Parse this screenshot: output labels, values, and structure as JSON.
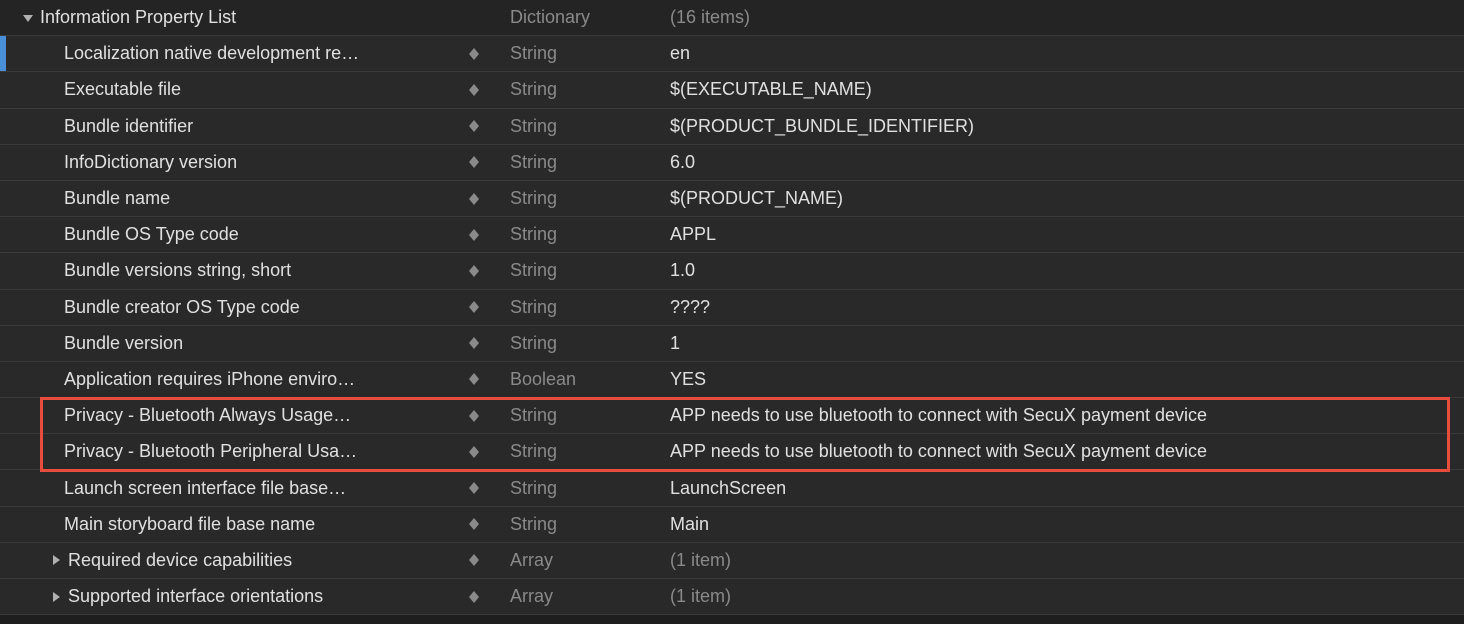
{
  "root": {
    "key": "Information Property List",
    "type": "Dictionary",
    "value": "(16 items)"
  },
  "rows": [
    {
      "key": "Localization native development re…",
      "type": "String",
      "value": "en",
      "stepper": true,
      "selected": true
    },
    {
      "key": "Executable file",
      "type": "String",
      "value": "$(EXECUTABLE_NAME)",
      "stepper": true
    },
    {
      "key": "Bundle identifier",
      "type": "String",
      "value": "$(PRODUCT_BUNDLE_IDENTIFIER)",
      "stepper": true
    },
    {
      "key": "InfoDictionary version",
      "type": "String",
      "value": "6.0",
      "stepper": true
    },
    {
      "key": "Bundle name",
      "type": "String",
      "value": "$(PRODUCT_NAME)",
      "stepper": true
    },
    {
      "key": "Bundle OS Type code",
      "type": "String",
      "value": "APPL",
      "stepper": true
    },
    {
      "key": "Bundle versions string, short",
      "type": "String",
      "value": "1.0",
      "stepper": true
    },
    {
      "key": "Bundle creator OS Type code",
      "type": "String",
      "value": "????",
      "stepper": true
    },
    {
      "key": "Bundle version",
      "type": "String",
      "value": "1",
      "stepper": true
    },
    {
      "key": "Application requires iPhone enviro…",
      "type": "Boolean",
      "value": "YES",
      "stepper": true
    },
    {
      "key": "Privacy - Bluetooth Always Usage…",
      "type": "String",
      "value": "APP needs to use bluetooth to connect with SecuX payment device",
      "stepper": true,
      "highlight": true
    },
    {
      "key": "Privacy - Bluetooth Peripheral Usa…",
      "type": "String",
      "value": "APP needs to use bluetooth to connect with SecuX payment device",
      "stepper": true,
      "highlight": true
    },
    {
      "key": "Launch screen interface file base…",
      "type": "String",
      "value": "LaunchScreen",
      "stepper": true
    },
    {
      "key": "Main storyboard file base name",
      "type": "String",
      "value": "Main",
      "stepper": true
    },
    {
      "key": "Required device capabilities",
      "type": "Array",
      "value": "(1 item)",
      "stepper": true,
      "disclosure": "right",
      "dim": true
    },
    {
      "key": "Supported interface orientations",
      "type": "Array",
      "value": "(1 item)",
      "stepper": true,
      "disclosure": "right",
      "dim": true
    }
  ]
}
